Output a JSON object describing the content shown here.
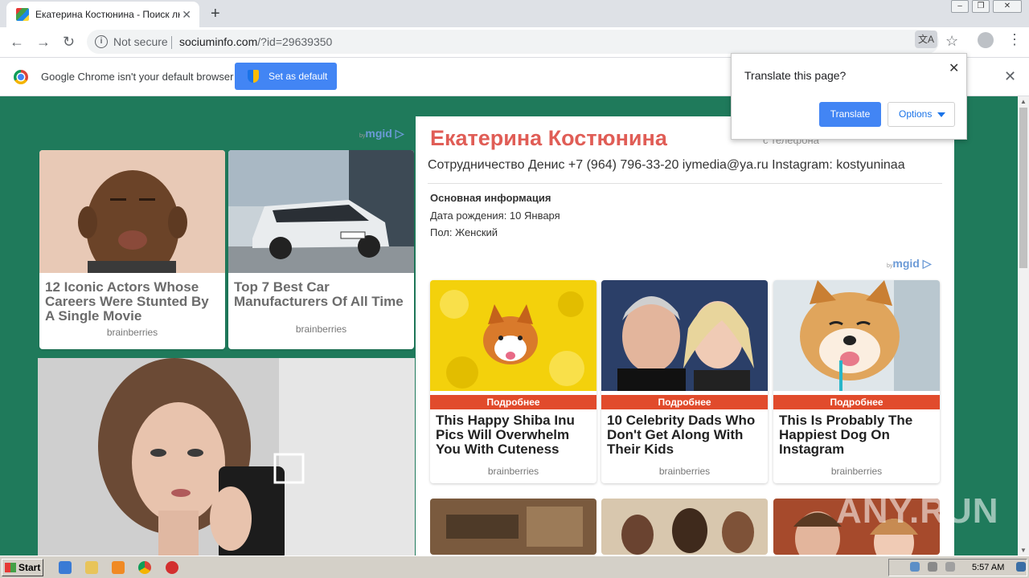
{
  "browser": {
    "tab_title": "Екатерина Костюнина - Поиск люд...",
    "new_tab_symbol": "+",
    "security_label": "Not secure",
    "url_domain": "sociuminfo.com",
    "url_rest": "/?id=29639350"
  },
  "infobar": {
    "message": "Google Chrome isn't your default browser",
    "button_label": "Set as default"
  },
  "translate_popup": {
    "question": "Translate this page?",
    "translate_label": "Translate",
    "options_label": "Options"
  },
  "left_ads": {
    "mgid_label": "mgid",
    "cards": [
      {
        "title": "12 Iconic Actors Whose Careers Were Stunted By A Single Movie",
        "source": "brainberries"
      },
      {
        "title": "Top 7 Best Car Manufacturers Of All Time",
        "source": "brainberries"
      }
    ]
  },
  "profile": {
    "name": "Екатерина Костюнина",
    "ghost_text": "с телефона",
    "status": "Сотрудничество Денис +7 (964) 796-33-20 iymedia@ya.ru Instagram: kostyuninaa",
    "section_title": "Основная информация",
    "birthday": "Дата рождения: 10 Января",
    "gender": "Пол: Женский"
  },
  "right_ads": {
    "mgid_label": "mgid",
    "more_label": "Подробнее",
    "tiles": [
      {
        "title": "This Happy Shiba Inu Pics Will Overwhelm You With Cuteness",
        "source": "brainberries"
      },
      {
        "title": "10 Celebrity Dads Who Don't Get Along With Their Kids",
        "source": "brainberries"
      },
      {
        "title": "This Is Probably The Happiest Dog On Instagram",
        "source": "brainberries"
      }
    ]
  },
  "watermark": "ANY.RUN",
  "taskbar": {
    "start_label": "Start",
    "clock": "5:57 AM"
  },
  "colors": {
    "page_background": "#1f7a5b",
    "name_color": "#e05d56",
    "more_bar": "#e14b2c",
    "chrome_blue": "#4285f4"
  }
}
